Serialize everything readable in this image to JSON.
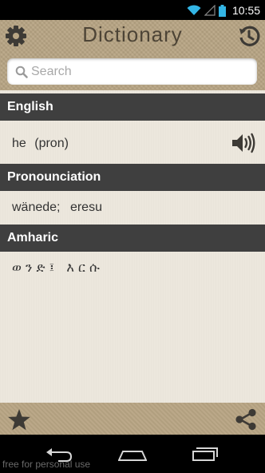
{
  "status_bar": {
    "time": "10:55"
  },
  "header": {
    "title": "Dictionary"
  },
  "search": {
    "placeholder": "Search",
    "value": ""
  },
  "sections": {
    "english": {
      "header": "English",
      "word": "he",
      "pos": "(pron)"
    },
    "pronunciation": {
      "header": "Pronounciation",
      "value1": "wänede;",
      "value2": "eresu"
    },
    "amharic": {
      "header": "Amharic",
      "value": "ወ ን ድ ፤   እ ር ሱ"
    }
  },
  "icons": {
    "settings": "gear-icon",
    "history": "history-icon",
    "search": "search-icon",
    "speaker": "speaker-icon",
    "favorite": "star-icon",
    "share": "share-icon",
    "back": "back-icon",
    "home": "home-icon",
    "recents": "recents-icon"
  },
  "watermark": "free for personal use",
  "colors": {
    "header_bg": "#b8a584",
    "section_header_bg": "#3f3f3f",
    "content_bg": "#ece7dd"
  }
}
